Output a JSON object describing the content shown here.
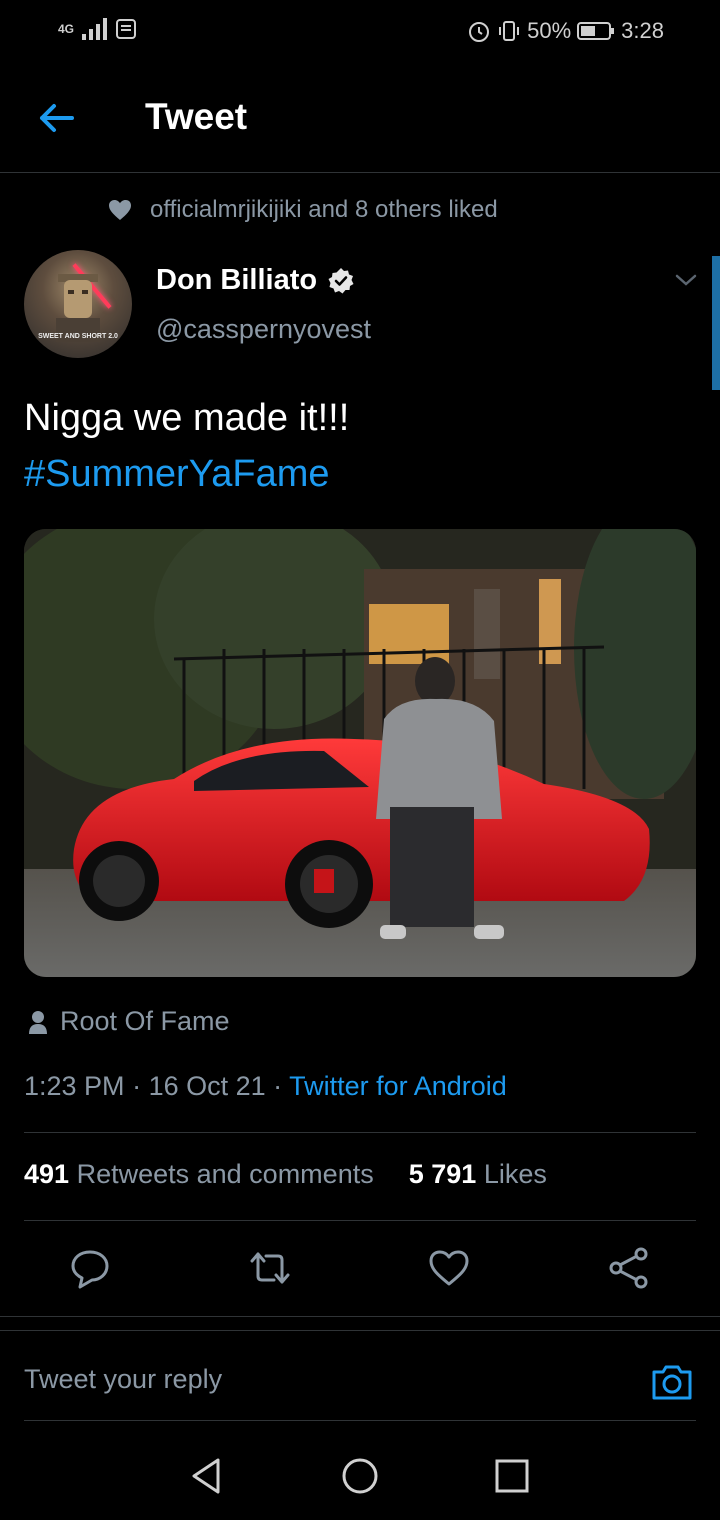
{
  "status_bar": {
    "network": "4G",
    "battery": "50%",
    "time": "3:28"
  },
  "header": {
    "title": "Tweet"
  },
  "social_context": {
    "text": "officialmrjikijiki and 8 others liked"
  },
  "author": {
    "name": "Don Billiato",
    "handle": "@casspernyovest",
    "avatar_text": "SWEET AND SHORT 2.0"
  },
  "tweet": {
    "text": "Nigga we made it!!!",
    "hashtag": "#SummerYaFame",
    "location": "Root Of Fame",
    "time": "1:23 PM",
    "date": "16 Oct 21",
    "source": "Twitter for Android"
  },
  "stats": {
    "retweets_count": "491",
    "retweets_label": "Retweets and comments",
    "likes_count": "5 791",
    "likes_label": "Likes"
  },
  "reply": {
    "placeholder": "Tweet your reply"
  },
  "colors": {
    "accent": "#1d9bf0",
    "muted": "#8b98a5",
    "background": "#000000"
  }
}
